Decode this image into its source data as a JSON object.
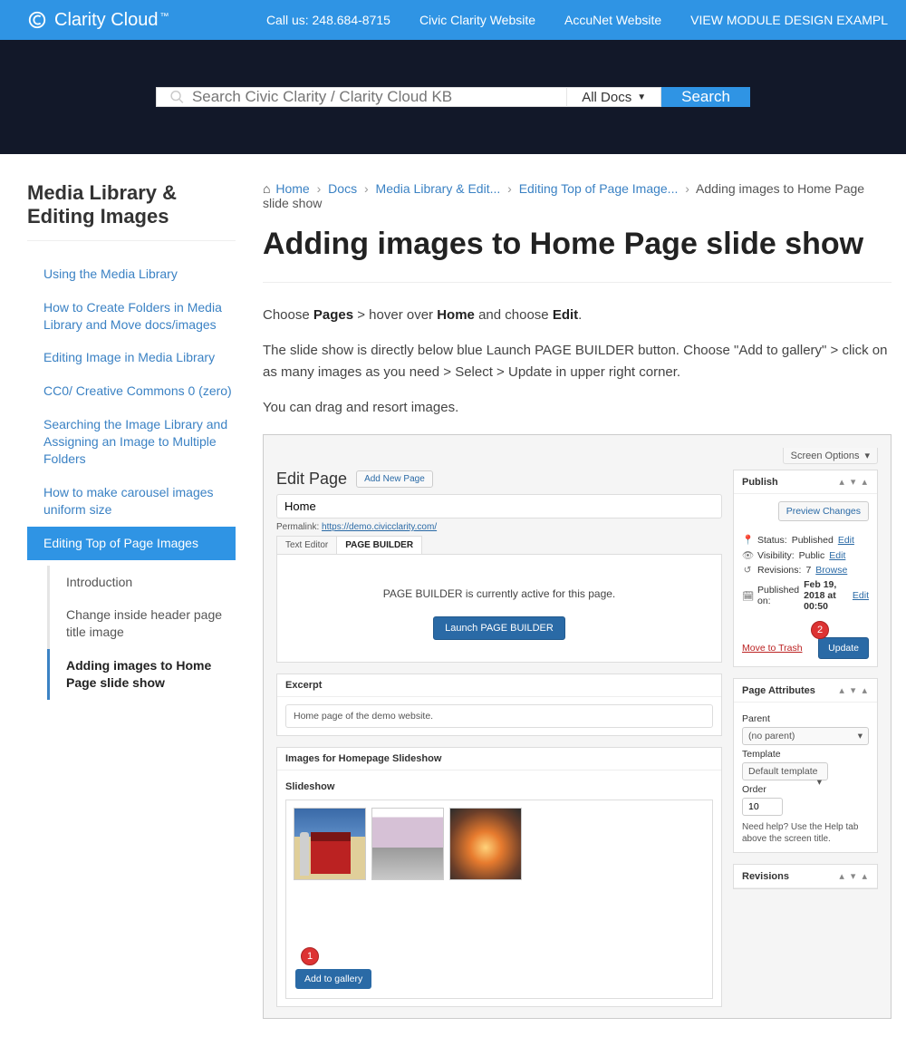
{
  "topbar": {
    "brand": "Clarity Cloud",
    "tm": "™",
    "call": "Call us: 248.684-8715",
    "links": [
      "Civic Clarity Website",
      "AccuNet Website",
      "VIEW MODULE DESIGN EXAMPL"
    ]
  },
  "search": {
    "placeholder": "Search Civic Clarity / Clarity Cloud KB",
    "scope": "All Docs",
    "button": "Search"
  },
  "sidebar": {
    "category": "Media Library & Editing Images",
    "items": [
      "Using the Media Library",
      "How to Create Folders in Media Library and Move docs/images",
      "Editing Image in Media Library",
      "CC0/ Creative Commons 0 (zero)",
      "Searching the Image Library and Assigning an Image to Multiple Folders",
      "How to make carousel images uniform size",
      "Editing Top of Page Images"
    ],
    "sub": [
      "Introduction",
      "Change inside header page title image",
      "Adding images to Home Page slide show"
    ]
  },
  "crumbs": {
    "home": "Home",
    "docs": "Docs",
    "cat": "Media Library & Edit...",
    "parent": "Editing Top of Page Image...",
    "current": "Adding images to Home Page slide show"
  },
  "title": "Adding images to Home Page slide show",
  "body": {
    "p1a": "Choose ",
    "p1b": "Pages",
    "p1c": " > hover over ",
    "p1d": "Home",
    "p1e": " and choose ",
    "p1f": "Edit",
    "p1g": ".",
    "p2": "The slide show is directly below blue Launch PAGE BUILDER button.  Choose \"Add to gallery\" > click on as many images as you need > Select > Update in upper right corner.",
    "p3": "You can drag and resort images."
  },
  "shot": {
    "screen_options": "Screen Options",
    "edit_page": "Edit Page",
    "add_new": "Add New Page",
    "page_title_value": "Home",
    "permalink_label": "Permalink:",
    "permalink_url": "https://demo.civicclarity.com/",
    "tab_text": "Text Editor",
    "tab_pb": "PAGE BUILDER",
    "pb_msg": "PAGE BUILDER is currently active for this page.",
    "pb_launch": "Launch PAGE BUILDER",
    "excerpt_head": "Excerpt",
    "excerpt_val": "Home page of the demo website.",
    "images_head": "Images for Homepage Slideshow",
    "slideshow_label": "Slideshow",
    "add_gallery": "Add to gallery",
    "publish_head": "Publish",
    "preview": "Preview Changes",
    "status_label": "Status:",
    "status_value": "Published",
    "edit_link": "Edit",
    "visibility_label": "Visibility:",
    "visibility_value": "Public",
    "revisions_label": "Revisions:",
    "revisions_value": "7",
    "browse_link": "Browse",
    "published_label": "Published on:",
    "published_value": "Feb 19, 2018 at 00:50",
    "trash": "Move to Trash",
    "update": "Update",
    "attrs_head": "Page Attributes",
    "parent_label": "Parent",
    "parent_value": "(no parent)",
    "template_label": "Template",
    "template_value": "Default template",
    "order_label": "Order",
    "order_value": "10",
    "help": "Need help? Use the Help tab above the screen title.",
    "revisions_head": "Revisions"
  }
}
